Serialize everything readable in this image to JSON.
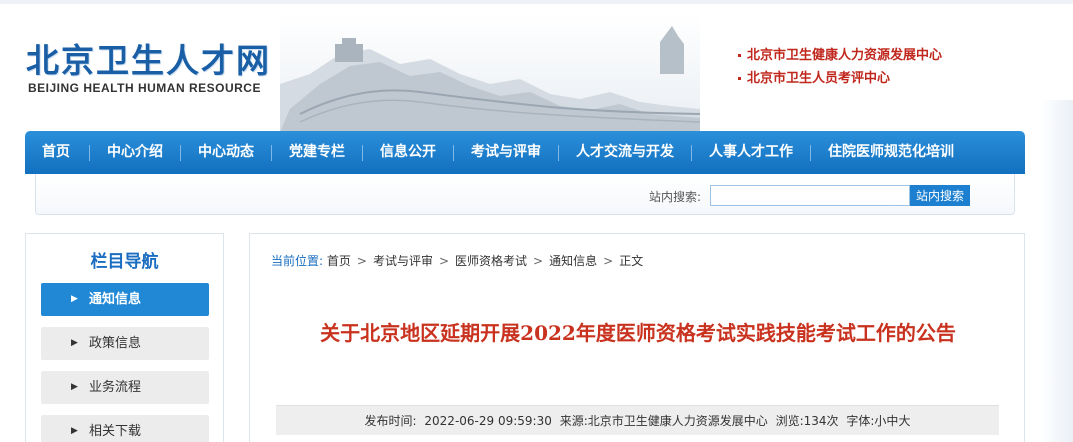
{
  "header": {
    "logo_cn": "北京卫生人才网",
    "logo_en": "BEIJING HEALTH HUMAN RESOURCE",
    "center_links": [
      "北京市卫生健康人力资源发展中心",
      "北京市卫生人员考评中心"
    ]
  },
  "nav": {
    "items": [
      "首页",
      "中心介绍",
      "中心动态",
      "党建专栏",
      "信息公开",
      "考试与评审",
      "人才交流与开发",
      "人事人才工作",
      "住院医师规范化培训"
    ]
  },
  "search": {
    "label": "站内搜索:",
    "value": "",
    "button": "站内搜索"
  },
  "sidebar": {
    "title": "栏目导航",
    "items": [
      {
        "label": "通知信息",
        "active": true
      },
      {
        "label": "政策信息",
        "active": false
      },
      {
        "label": "业务流程",
        "active": false
      },
      {
        "label": "相关下载",
        "active": false
      }
    ]
  },
  "breadcrumb": {
    "prefix": "当前位置:",
    "items": [
      "首页",
      "考试与评审",
      "医师资格考试",
      "通知信息",
      "正文"
    ],
    "separator": ">"
  },
  "article": {
    "title": "关于北京地区延期开展2022年度医师资格考试实践技能考试工作的公告",
    "meta": {
      "published_label": "发布时间:",
      "published": "2022-06-29 09:59:30",
      "source_label": "来源:",
      "source": "北京市卫生健康人力资源发展中心",
      "views_label": "浏览:",
      "views": "134次",
      "font_label": "字体:",
      "font_small": "小",
      "font_medium": "中",
      "font_large": "大"
    }
  },
  "colors": {
    "brand_blue": "#1a6dc0",
    "nav_blue": "#1c7fd0",
    "title_red": "#c8321e",
    "link_red": "#c0271d"
  }
}
